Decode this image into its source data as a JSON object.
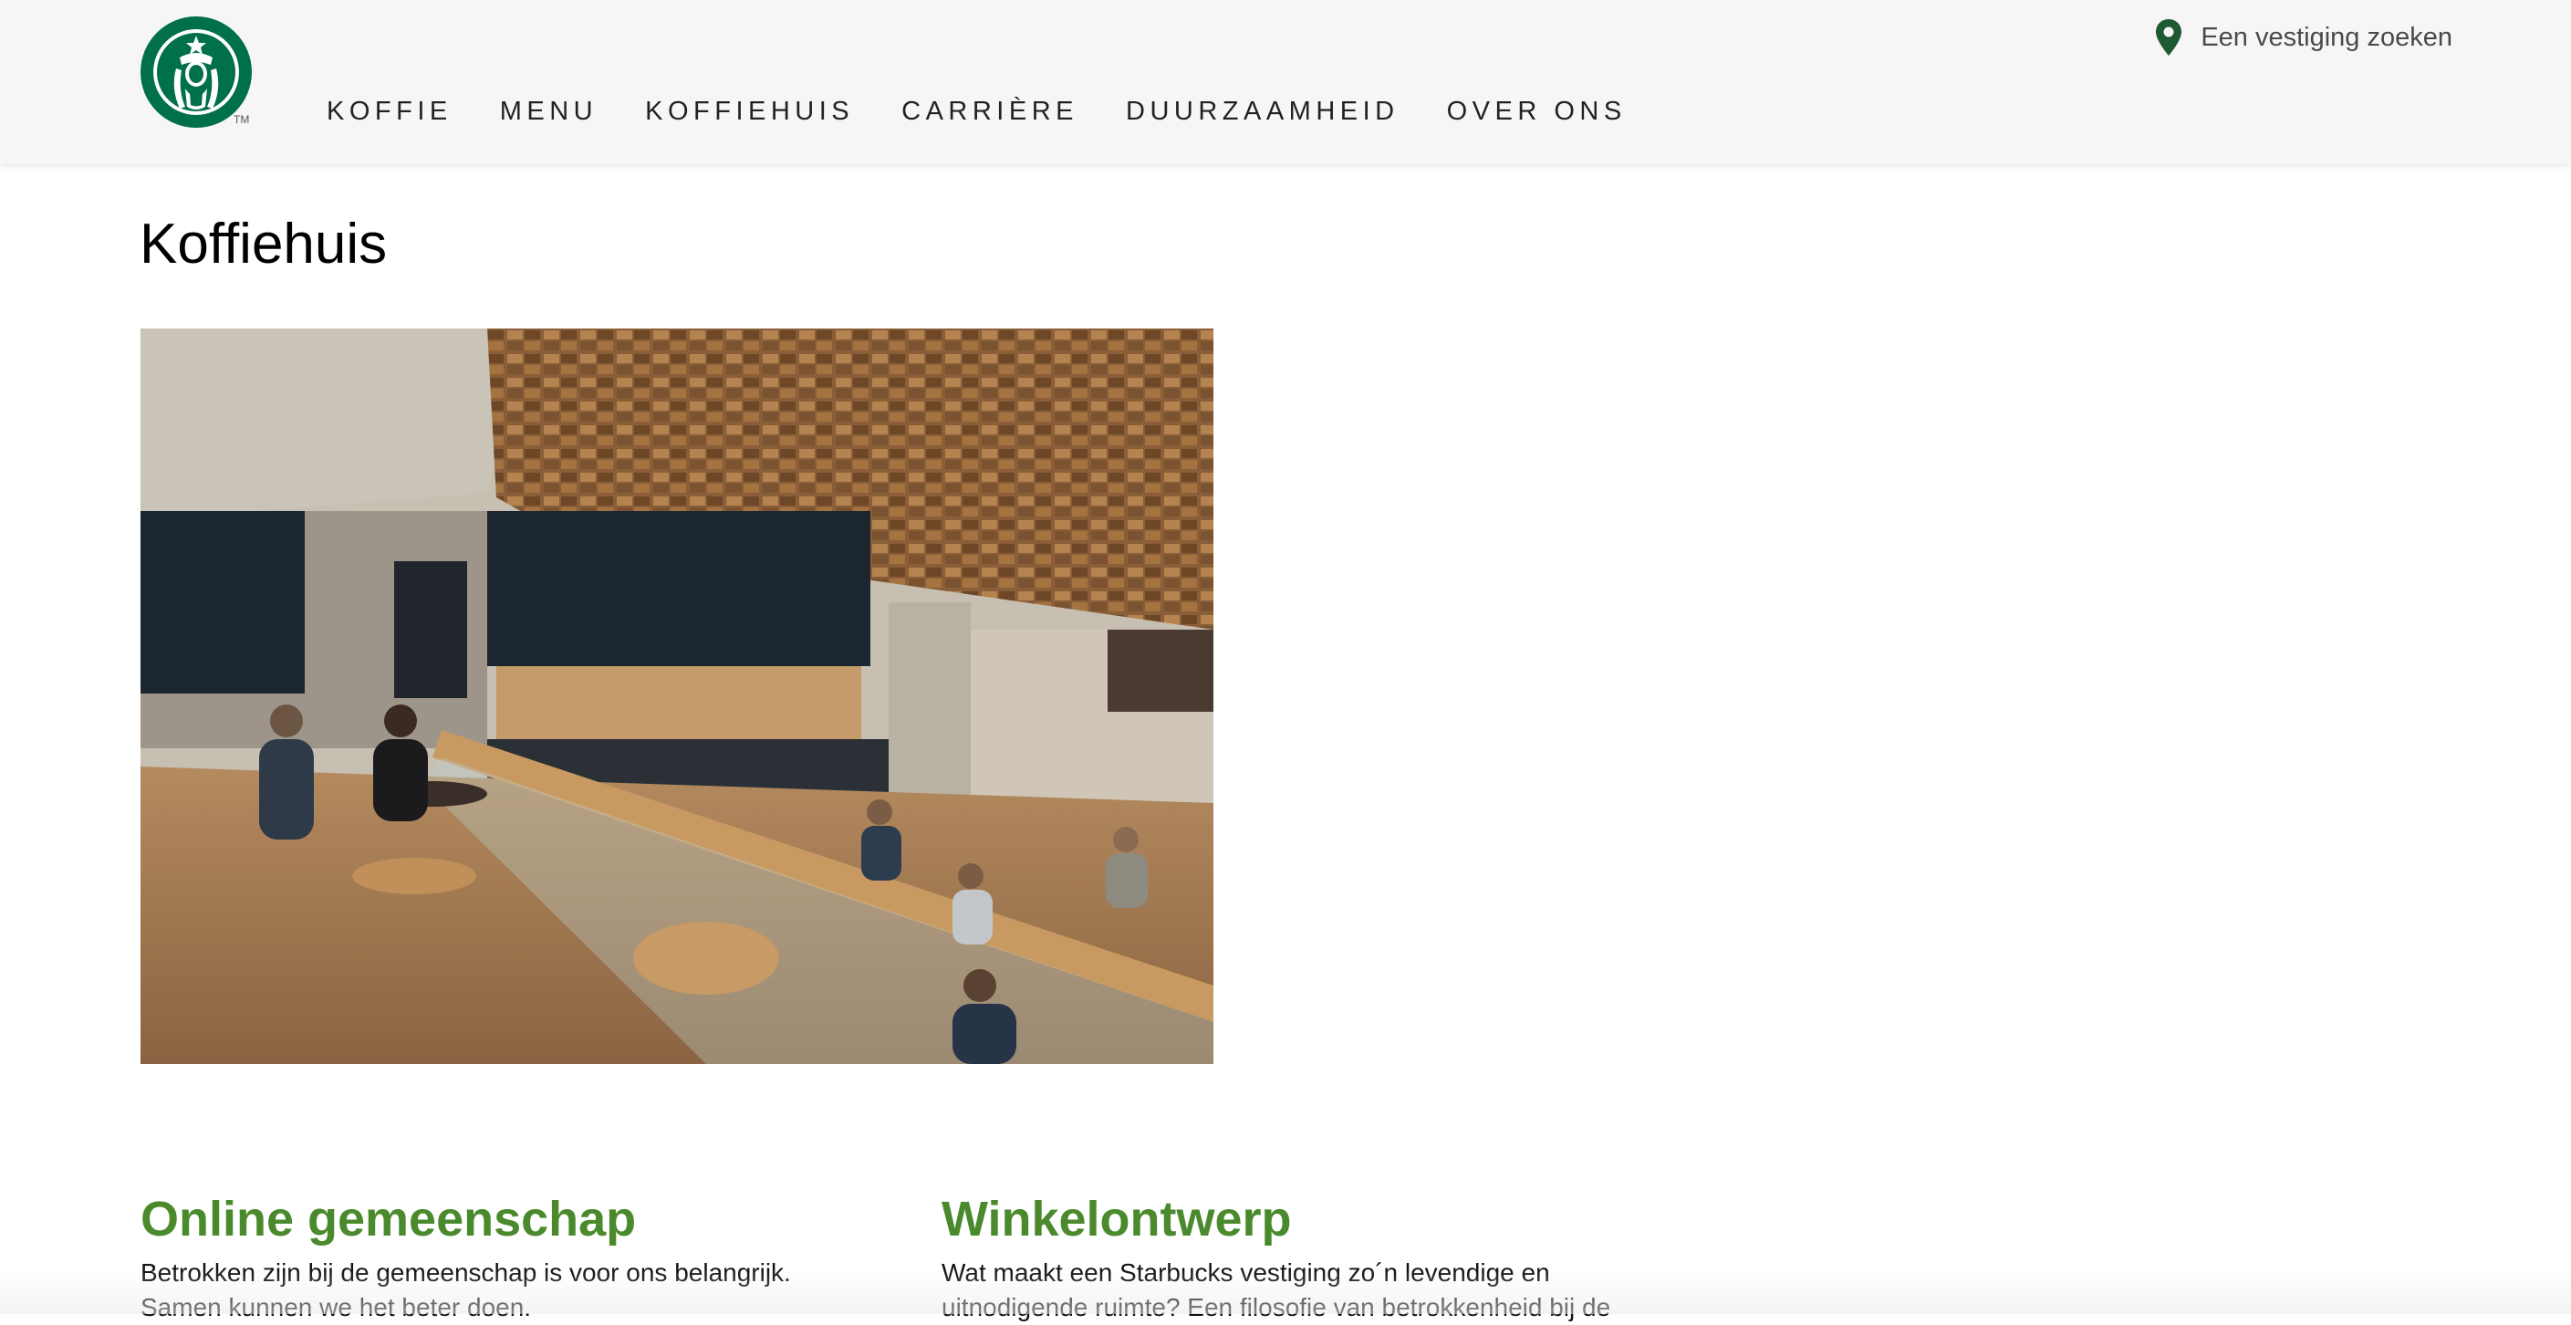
{
  "header": {
    "logo_alt": "Starbucks",
    "trademark": "TM",
    "nav": [
      {
        "label": "KOFFIE"
      },
      {
        "label": "MENU"
      },
      {
        "label": "KOFFIEHUIS"
      },
      {
        "label": "CARRIÈRE"
      },
      {
        "label": "DUURZAAMHEID"
      },
      {
        "label": "OVER ONS"
      }
    ],
    "store_finder": {
      "label": "Een vestiging zoeken",
      "icon": "location-pin-icon"
    }
  },
  "main": {
    "title": "Koffiehuis",
    "hero_image_alt": "Starbucks koffiehuis interieur",
    "sections": [
      {
        "heading": "Online gemeenschap",
        "text": "Betrokken zijn bij de gemeenschap is voor ons belangrijk. Samen kunnen we het beter doen."
      },
      {
        "heading": "Winkelontwerp",
        "text": "Wat maakt een Starbucks vestiging zo´n levendige en uitnodigende ruimte? Een filosofie van betrokkenheid bij de"
      }
    ]
  },
  "colors": {
    "brand_green": "#00704A",
    "heading_green": "#4a8a2c",
    "header_bg": "#f6f6f6",
    "pin_green": "#1e5a32"
  }
}
